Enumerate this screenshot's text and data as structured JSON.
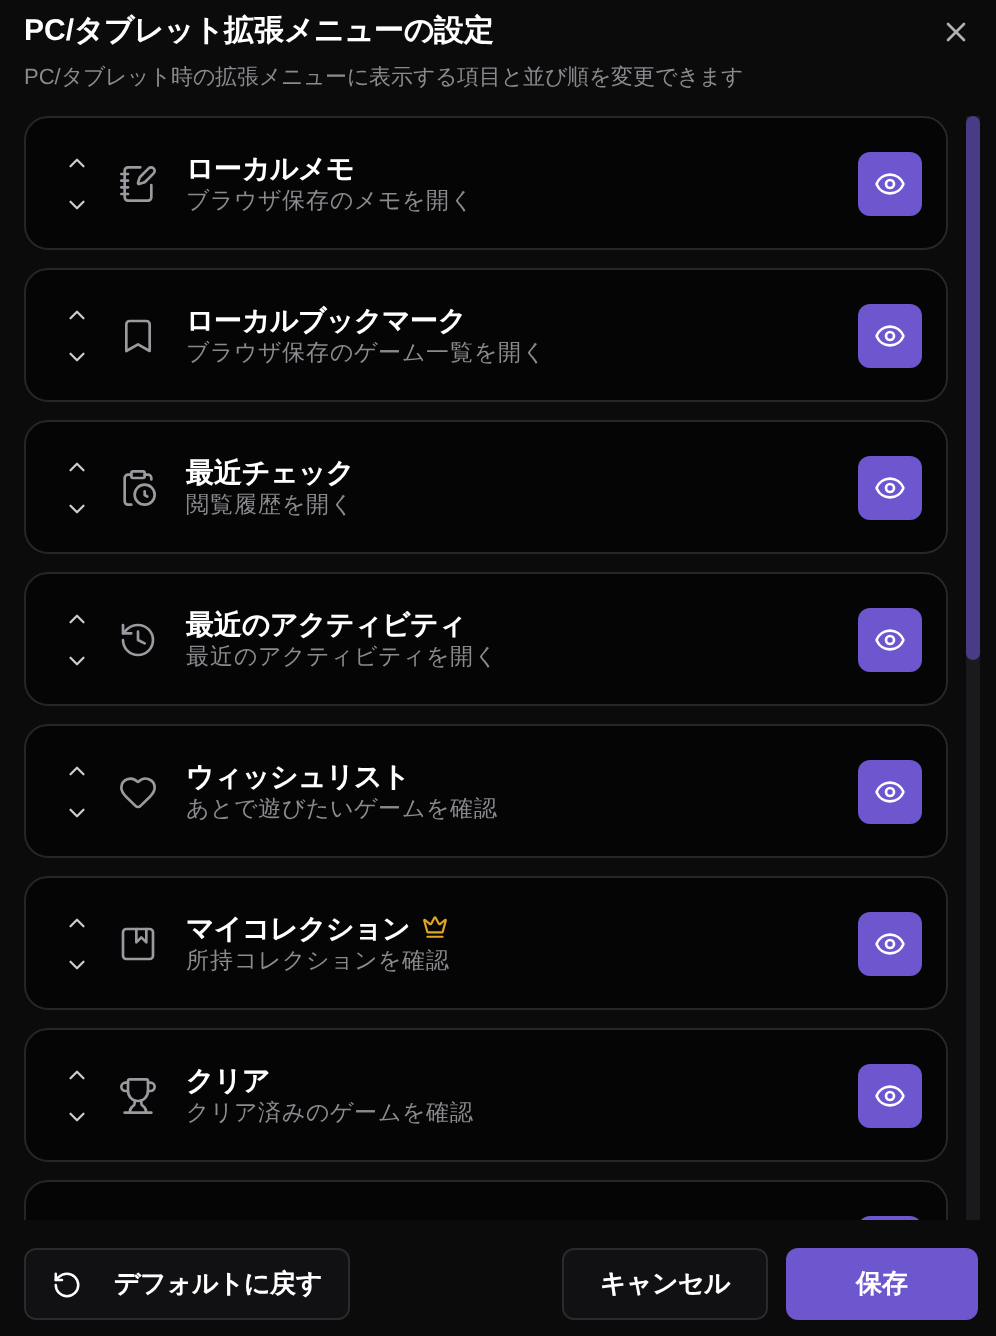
{
  "dialog": {
    "title": "PC/タブレット拡張メニューの設定",
    "subtitle": "PC/タブレット時の拡張メニューに表示する項目と並び順を変更できます"
  },
  "items": [
    {
      "title": "ローカルメモ",
      "description": "ブラウザ保存のメモを開く",
      "visible": true,
      "premium": false
    },
    {
      "title": "ローカルブックマーク",
      "description": "ブラウザ保存のゲーム一覧を開く",
      "visible": true,
      "premium": false
    },
    {
      "title": "最近チェック",
      "description": "閲覧履歴を開く",
      "visible": true,
      "premium": false
    },
    {
      "title": "最近のアクティビティ",
      "description": "最近のアクティビティを開く",
      "visible": true,
      "premium": false
    },
    {
      "title": "ウィッシュリスト",
      "description": "あとで遊びたいゲームを確認",
      "visible": true,
      "premium": false
    },
    {
      "title": "マイコレクション",
      "description": "所持コレクションを確認",
      "visible": true,
      "premium": true
    },
    {
      "title": "クリア",
      "description": "クリア済みのゲームを確認",
      "visible": true,
      "premium": false
    },
    {
      "visible": true
    }
  ],
  "footer": {
    "reset": "デフォルトに戻す",
    "cancel": "キャンセル",
    "save": "保存"
  }
}
